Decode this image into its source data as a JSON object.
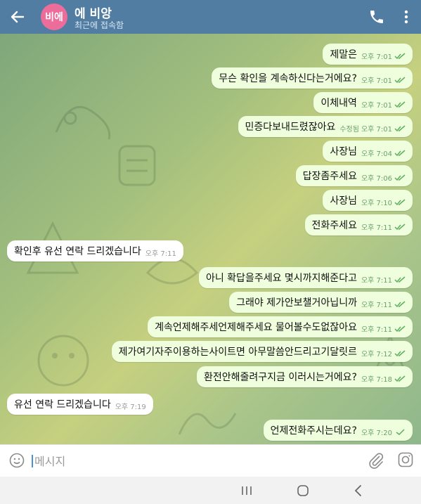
{
  "header": {
    "avatar_initials": "비에",
    "avatar_color": "#ec6d9a",
    "title": "에 비앙",
    "status": "최근에 접속함",
    "bar_color": "#527da3",
    "icons": [
      "back-arrow-icon",
      "phone-icon",
      "more-vert-icon"
    ]
  },
  "messages": [
    {
      "dir": "out",
      "text": "제말은",
      "time": "오후 7:01",
      "edited": "",
      "read": true
    },
    {
      "dir": "out",
      "text": "무슨 확인을 계속하신다는거에요?",
      "time": "오후 7:01",
      "edited": "",
      "read": true
    },
    {
      "dir": "out",
      "text": "이체내역",
      "time": "오후 7:01",
      "edited": "",
      "read": true
    },
    {
      "dir": "out",
      "text": "민증다보내드렸잖아요",
      "time": "오후 7:01",
      "edited": "수정됨",
      "read": true
    },
    {
      "dir": "out",
      "text": "사장님",
      "time": "오후 7:04",
      "edited": "",
      "read": true
    },
    {
      "dir": "out",
      "text": "답장좀주세요",
      "time": "오후 7:06",
      "edited": "",
      "read": true
    },
    {
      "dir": "out",
      "text": "사장님",
      "time": "오후 7:10",
      "edited": "",
      "read": true
    },
    {
      "dir": "out",
      "text": "전화주세요",
      "time": "오후 7:11",
      "edited": "",
      "read": true
    },
    {
      "dir": "in",
      "text": "확인후 유선 연락 드리겠습니다",
      "time": "오후 7:11"
    },
    {
      "dir": "out",
      "text": "아니 확답을주세요 몇시까지해준다고",
      "time": "오후 7:11",
      "edited": "",
      "read": true
    },
    {
      "dir": "out",
      "text": "그래야 제가안보챌거아닙니까",
      "time": "오후 7:11",
      "edited": "",
      "read": true
    },
    {
      "dir": "out",
      "text": "계속언제해주세언제해주세요 물어볼수도없잖아요",
      "time": "오후 7:11",
      "edited": "",
      "read": true
    },
    {
      "dir": "out",
      "text": "제가여기자주이용하는사이트면 아무말씀안드리고기달릿르",
      "time": "오후 7:12",
      "edited": "",
      "read": true
    },
    {
      "dir": "out",
      "text": "환전안해줄려구지금 이러시는거에요?",
      "time": "오후 7:18",
      "edited": "",
      "read": true
    },
    {
      "dir": "in",
      "text": "유선 연락 드리겠습니다",
      "time": "오후 7:19"
    },
    {
      "dir": "out",
      "text": "언제전화주시는데요?",
      "time": "오후 7:20",
      "edited": "",
      "read": false
    }
  ],
  "input": {
    "placeholder": "메시지",
    "icons": [
      "emoji-icon",
      "attach-icon",
      "camera-icon"
    ]
  },
  "navbar": {
    "icons": [
      "recent-apps-icon",
      "home-icon",
      "back-icon"
    ]
  },
  "colors": {
    "outgoing_bubble": "#effedd",
    "incoming_bubble": "#ffffff",
    "time_outgoing": "#6aa26a",
    "time_incoming": "#9a9a9a"
  }
}
